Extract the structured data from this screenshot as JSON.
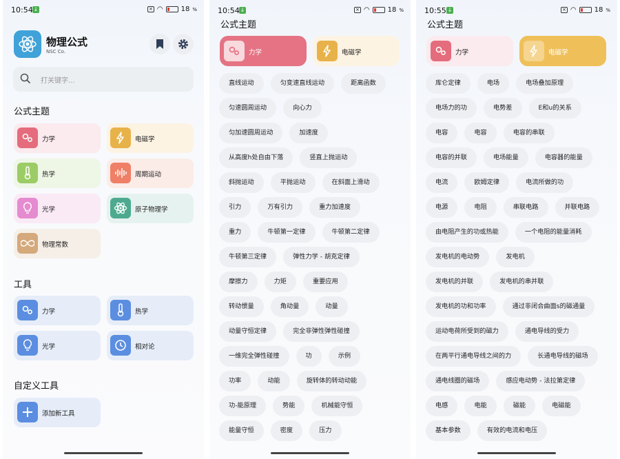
{
  "status": [
    {
      "time": "10:54",
      "battery": "18"
    },
    {
      "time": "10:54",
      "battery": "18"
    },
    {
      "time": "10:55",
      "battery": "18"
    }
  ],
  "home": {
    "app_title": "物理公式",
    "app_subtitle": "NSC Co.",
    "search_placeholder": "打关键字...",
    "topics_heading": "公式主题",
    "topics": [
      {
        "label": "力学",
        "icon": "gears-icon",
        "color": "#e46c7c",
        "bg": "#fbeaee"
      },
      {
        "label": "电磁学",
        "icon": "lightning-icon",
        "color": "#e8b24a",
        "bg": "#fdf3e3"
      },
      {
        "label": "热学",
        "icon": "thermometer-icon",
        "color": "#9ccc65",
        "bg": "#eef6e6"
      },
      {
        "label": "周期运动",
        "icon": "waveform-icon",
        "color": "#ef7f66",
        "bg": "#fbece8"
      },
      {
        "label": "光学",
        "icon": "bulb-icon",
        "color": "#e58bd0",
        "bg": "#faeaf6"
      },
      {
        "label": "原子物理学",
        "icon": "atom-icon",
        "color": "#4daa8f",
        "bg": "#e6f2ef"
      },
      {
        "label": "物理常数",
        "icon": "infinity-icon",
        "color": "#d4a97c",
        "bg": "#f6efe7"
      }
    ],
    "tools_heading": "工具",
    "tools": [
      {
        "label": "力学",
        "icon": "gears-icon"
      },
      {
        "label": "热学",
        "icon": "thermometer-icon"
      },
      {
        "label": "光学",
        "icon": "bulb-icon"
      },
      {
        "label": "相对论",
        "icon": "clock-icon"
      }
    ],
    "custom_heading": "自定义工具",
    "add_tool_label": "添加新工具",
    "tool_color": "#5b8ee0",
    "tool_bg": "#e6edf9"
  },
  "mechanics": {
    "heading": "公式主题",
    "tabs": [
      {
        "label": "力学",
        "selected": true
      },
      {
        "label": "电磁学",
        "selected": false
      }
    ],
    "rows": [
      [
        "直线运动",
        "匀变速直线运动",
        "距离函数"
      ],
      [
        "匀速圆周运动",
        "向心力"
      ],
      [
        "匀加速圆周运动",
        "加速度"
      ],
      [
        "从高度h处自由下落",
        "竖直上抛运动"
      ],
      [
        "斜抛运动",
        "平抛运动",
        "在斜面上滑动"
      ],
      [
        "引力",
        "万有引力",
        "重力加速度"
      ],
      [
        "重力",
        "牛顿第一定律",
        "牛顿第二定律"
      ],
      [
        "牛顿第三定律",
        "弹性力学 - 胡克定律"
      ],
      [
        "摩擦力",
        "力矩",
        "重要应用"
      ],
      [
        "转动惯量",
        "角动量",
        "动量"
      ],
      [
        "动量守恒定律",
        "完全非弹性弹性碰撞"
      ],
      [
        "一维完全弹性碰撞",
        "功",
        "示例"
      ],
      [
        "功率",
        "动能",
        "旋转体的转动动能"
      ],
      [
        "功-能原理",
        "势能",
        "机械能守恒"
      ],
      [
        "能量守恒",
        "密度",
        "压力"
      ]
    ]
  },
  "electro": {
    "heading": "公式主题",
    "tabs": [
      {
        "label": "力学",
        "selected": false
      },
      {
        "label": "电磁学",
        "selected": true
      }
    ],
    "rows": [
      [
        "库仑定律",
        "电场",
        "电场叠加原理"
      ],
      [
        "电场力的功",
        "电势差",
        "E和u的关系"
      ],
      [
        "电容",
        "电容",
        "电容的串联"
      ],
      [
        "电容的并联",
        "电场能量",
        "电容器的能量"
      ],
      [
        "电流",
        "欧姆定律",
        "电流所做的功"
      ],
      [
        "电源",
        "电阻",
        "串联电路",
        "并联电路"
      ],
      [
        "由电阻产生的功或热能",
        "一个电阻的能量消耗"
      ],
      [
        "发电机的电动势",
        "发电机"
      ],
      [
        "发电机的并联",
        "发电机的串并联"
      ],
      [
        "发电机的功和功率",
        "通过非闭合曲面s的磁通量"
      ],
      [
        "运动电荷所受到的磁力",
        "通电导线的受力"
      ],
      [
        "在两平行通电导线之间的力",
        "长通电导线的磁场"
      ],
      [
        "通电线圈的磁场",
        "感应电动势 - 法拉第定律"
      ],
      [
        "电感",
        "电能",
        "磁能",
        "电磁能"
      ],
      [
        "基本参数",
        "有效的电流和电压"
      ]
    ]
  }
}
